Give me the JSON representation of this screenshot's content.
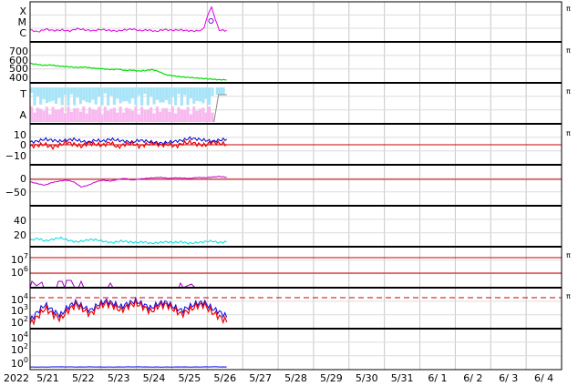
{
  "chart_data": {
    "type": "line",
    "x_start_label": "2022",
    "x_ticks": [
      "5/21",
      "5/22",
      "5/23",
      "5/24",
      "5/25",
      "5/26",
      "5/27",
      "5/28",
      "5/29",
      "5/30",
      "5/31",
      "6/ 1",
      "6/ 2",
      "6/ 3",
      "6/ 4"
    ],
    "x_range_days": [
      0,
      15
    ],
    "data_end_day": 5.55,
    "grid": true,
    "panels": [
      {
        "id": "xray_class",
        "tick_labels": [
          "X",
          "M",
          "C"
        ],
        "right_mark": "π",
        "series": [
          {
            "color": "#e000e0",
            "samples": [
              0.3,
              0.25,
              0.32,
              0.28,
              0.3,
              0.27,
              0.33,
              0.3,
              0.28,
              0.31,
              0.29,
              0.27,
              0.3,
              0.32,
              0.28,
              0.3,
              0.26,
              0.31,
              0.29,
              0.3,
              0.28,
              0.27,
              0.3,
              0.9,
              0.3,
              0.28
            ],
            "has_peak_marker": true
          }
        ]
      },
      {
        "id": "solar_wind_speed",
        "tick_labels": [
          "700",
          "600",
          "500",
          "400"
        ],
        "ylim": [
          350,
          750
        ],
        "right_mark": "π",
        "series": [
          {
            "color": "#00dd00",
            "samples": [
              540,
              530,
              520,
              525,
              515,
              510,
              505,
              500,
              505,
              495,
              490,
              485,
              480,
              485,
              470,
              475,
              465,
              470,
              480,
              460,
              430,
              420,
              410,
              405,
              400,
              395,
              390,
              385,
              380,
              380
            ]
          }
        ]
      },
      {
        "id": "imf_direction",
        "tick_labels": [
          "T",
          "A"
        ],
        "right_mark": "π",
        "series": [
          {
            "color": "#a8e4f8",
            "name": ""
          },
          {
            "color": "#f8b8f0",
            "name": ""
          }
        ]
      },
      {
        "id": "imf_components",
        "tick_labels": [
          "10",
          "0",
          "−10"
        ],
        "ylim": [
          -20,
          20
        ],
        "right_mark": "π",
        "series": [
          {
            "color": "#0000cc",
            "samples": [
              2,
              3,
              5,
              4,
              3,
              4,
              5,
              3,
              2,
              4,
              3,
              5,
              4,
              3,
              2,
              4,
              3,
              2,
              1,
              2,
              3,
              4,
              6,
              5,
              4,
              3,
              4,
              5
            ]
          },
          {
            "color": "#ee0000",
            "samples": [
              -2,
              -1,
              0,
              -3,
              -1,
              2,
              0,
              -2,
              1,
              0,
              -1,
              2,
              -3,
              0,
              1,
              -2,
              0,
              1,
              -1,
              0,
              -2,
              1,
              2,
              0,
              -1,
              2,
              1,
              0
            ]
          }
        ]
      },
      {
        "id": "dst_index",
        "tick_labels": [
          "0",
          "−50"
        ],
        "ylim": [
          -80,
          40
        ],
        "series": [
          {
            "color": "#cc00cc",
            "samples": [
              -10,
              -15,
              -20,
              -12,
              -8,
              -5,
              -10,
              -25,
              -20,
              -10,
              -5,
              -8,
              -3,
              0,
              -5,
              -2,
              0,
              2,
              3,
              0,
              2,
              1,
              0,
              3,
              2,
              4,
              6,
              3
            ]
          }
        ]
      },
      {
        "id": "kp_like",
        "tick_labels": [
          "40",
          "20"
        ],
        "ylim": [
          0,
          50
        ],
        "series": [
          {
            "color": "#00dddd",
            "samples": [
              8,
              10,
              7,
              9,
              11,
              8,
              6,
              7,
              9,
              8,
              6,
              5,
              7,
              6,
              5,
              6,
              4,
              5,
              6,
              5,
              6,
              4,
              5,
              6,
              7,
              5,
              6
            ]
          }
        ]
      },
      {
        "id": "electron_flux",
        "tick_labels": [
          "10^7",
          "10^6"
        ],
        "right_mark": "π",
        "series": [
          {
            "color": "#a000c0",
            "samples": []
          }
        ]
      },
      {
        "id": "proton_flux",
        "tick_labels": [
          "10^4",
          "10^3",
          "10^2"
        ],
        "right_mark": "π",
        "series": [
          {
            "color": "#0000ee",
            "samples": [
              1.5,
              2.2,
              2.8,
              2.3,
              1.9,
              2.6,
              3.0,
              2.6,
              2.3,
              2.8,
              3.1,
              2.9,
              2.6,
              2.9,
              3.1,
              2.8,
              2.5,
              2.9,
              3.0,
              2.6,
              2.3,
              2.6,
              2.9,
              3.0,
              2.5,
              2.2,
              1.8
            ]
          },
          {
            "color": "#ee0000",
            "samples": [
              1.2,
              1.8,
              2.5,
              2.0,
              1.6,
              2.3,
              2.8,
              2.4,
              2.0,
              2.6,
              2.9,
              2.7,
              2.3,
              2.7,
              2.9,
              2.6,
              2.2,
              2.7,
              2.8,
              2.4,
              2.0,
              2.3,
              2.7,
              2.8,
              2.2,
              1.8,
              1.4
            ]
          }
        ]
      },
      {
        "id": "neutron",
        "tick_labels": [
          "10^4",
          "10^2",
          "10^0"
        ],
        "series": [
          {
            "color": "#0000ee",
            "samples": [
              0.1,
              0.1,
              0.12,
              0.1,
              0.11,
              0.1,
              0.1,
              0.12,
              0.1,
              0.1,
              0.11,
              0.1,
              0.12,
              0.1
            ]
          }
        ]
      }
    ]
  }
}
